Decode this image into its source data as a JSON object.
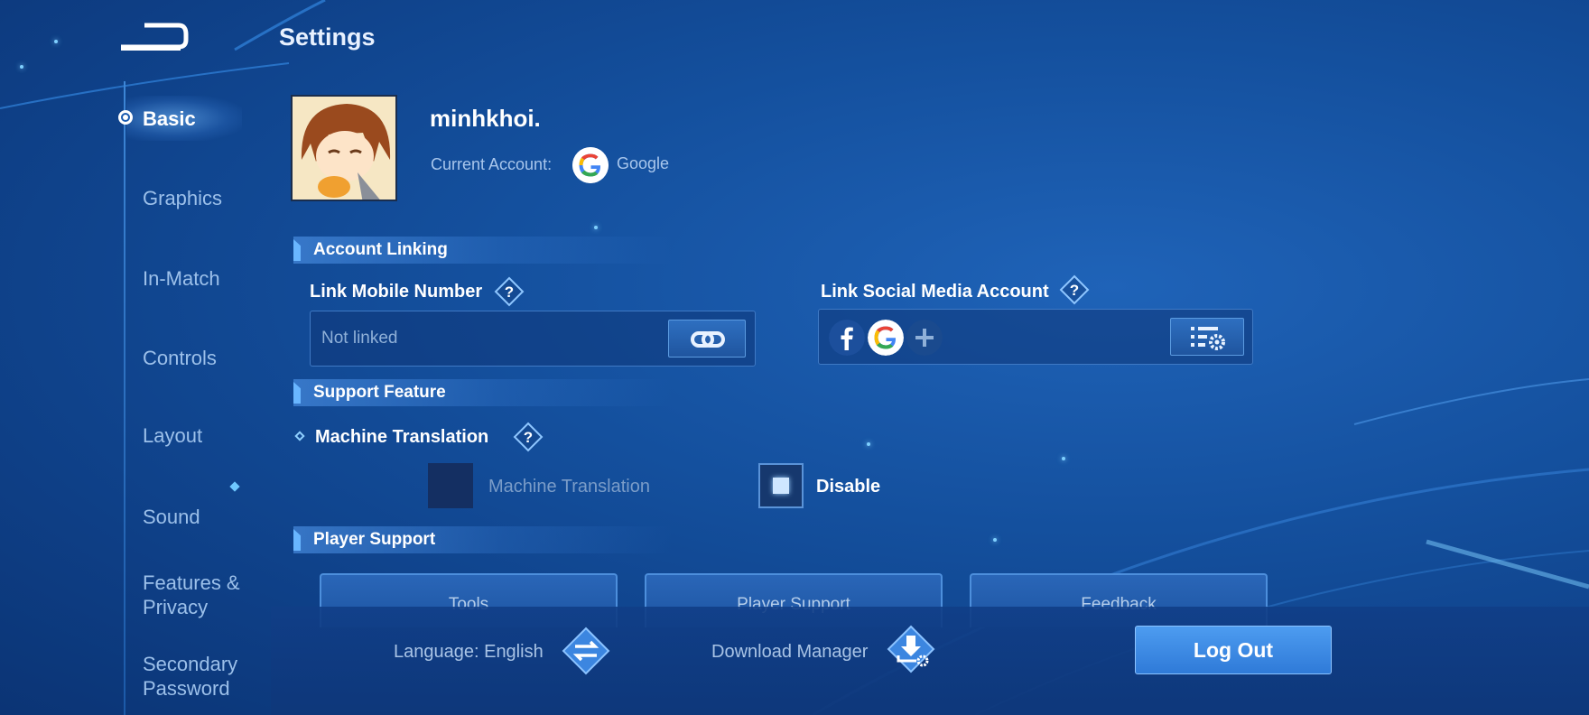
{
  "header": {
    "title": "Settings"
  },
  "sidebar": {
    "items": [
      {
        "label": "Basic"
      },
      {
        "label": "Graphics"
      },
      {
        "label": "In-Match"
      },
      {
        "label": "Controls"
      },
      {
        "label": "Layout"
      },
      {
        "label": "Sound"
      },
      {
        "label": "Features &",
        "label2": "Privacy"
      },
      {
        "label": "Secondary",
        "label2": "Password"
      }
    ]
  },
  "profile": {
    "username": "minhkhoi.",
    "current_account_label": "Current Account:",
    "account_provider": "Google"
  },
  "account_linking": {
    "heading": "Account Linking",
    "mobile_label": "Link Mobile Number",
    "mobile_value": "Not linked",
    "social_label": "Link Social Media Account"
  },
  "support_feature": {
    "heading": "Support Feature",
    "machine_translation_label": "Machine Translation",
    "option_on": "Machine Translation",
    "option_off": "Disable"
  },
  "player_support": {
    "heading": "Player Support",
    "buttons": [
      "Tools",
      "Player Support",
      "Feedback"
    ]
  },
  "footer": {
    "language": "Language: English",
    "download_manager": "Download Manager",
    "logout": "Log Out"
  },
  "icons": {
    "back": "back-arrow-icon",
    "help": "question-diamond-icon",
    "link": "chain-link-icon",
    "social": [
      "facebook-icon",
      "google-icon",
      "plus-icon"
    ],
    "manage": "list-gear-icon",
    "language": "swap-arrows-icon",
    "download": "download-gear-icon"
  },
  "colors": {
    "accent": "#4d9cf0",
    "background": "#14509e"
  }
}
